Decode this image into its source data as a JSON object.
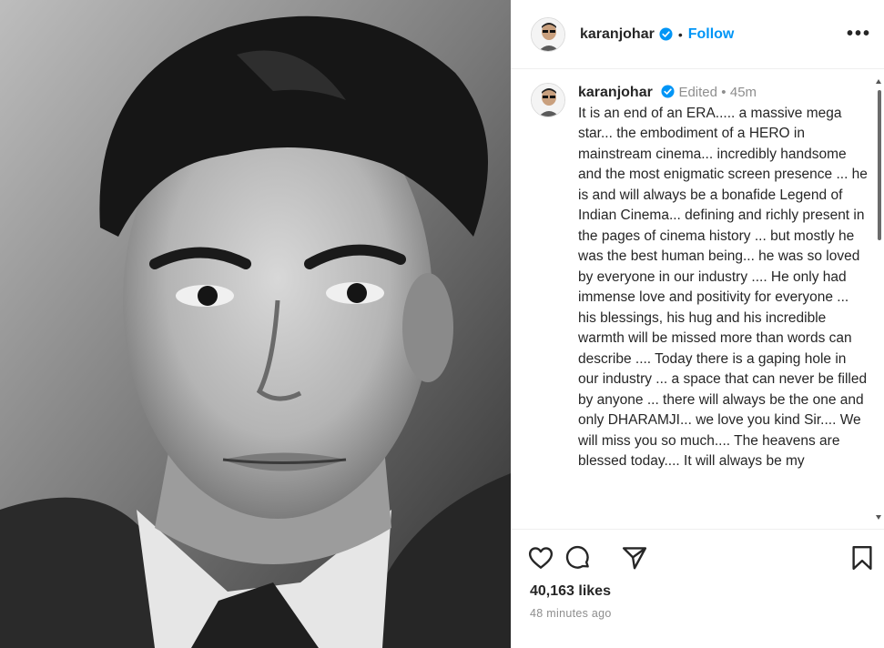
{
  "post": {
    "photo_subject": "black-and-white portrait of a man",
    "likes": "40,163 likes",
    "time_ago": "48 minutes ago"
  },
  "header": {
    "username": "karanjohar",
    "separator": "•",
    "follow_label": "Follow",
    "more_label": "•••"
  },
  "caption": {
    "username": "karanjohar",
    "edited_label": "Edited",
    "separator": "•",
    "time": "45m",
    "text": "It is an end of an ERA..... a massive mega star... the embodiment of a HERO in mainstream cinema... incredibly handsome and the most  enigmatic screen presence ... he is and will always be a bonafide Legend of Indian Cinema... defining and richly present in the pages of cinema history ... but mostly he was the best human being... he was so loved by everyone in our industry .... He only had immense love and positivity for everyone ... his blessings, his hug and his incredible warmth will be missed more than words can describe .... Today there is a gaping hole in our industry ... a space that can never be filled by anyone ... there will always be the  one and only DHARAMJI... we love you kind Sir.... We will miss you so much.... The heavens are blessed today.... It will always be my"
  },
  "icons": {
    "like": "heart-icon",
    "comment": "comment-icon",
    "share": "share-icon",
    "save": "bookmark-icon",
    "verified": "verified-badge-icon",
    "more": "more-options-icon"
  },
  "colors": {
    "accent": "#0095f6",
    "text": "#262626",
    "muted": "#8e8e8e",
    "border": "#efefef"
  }
}
